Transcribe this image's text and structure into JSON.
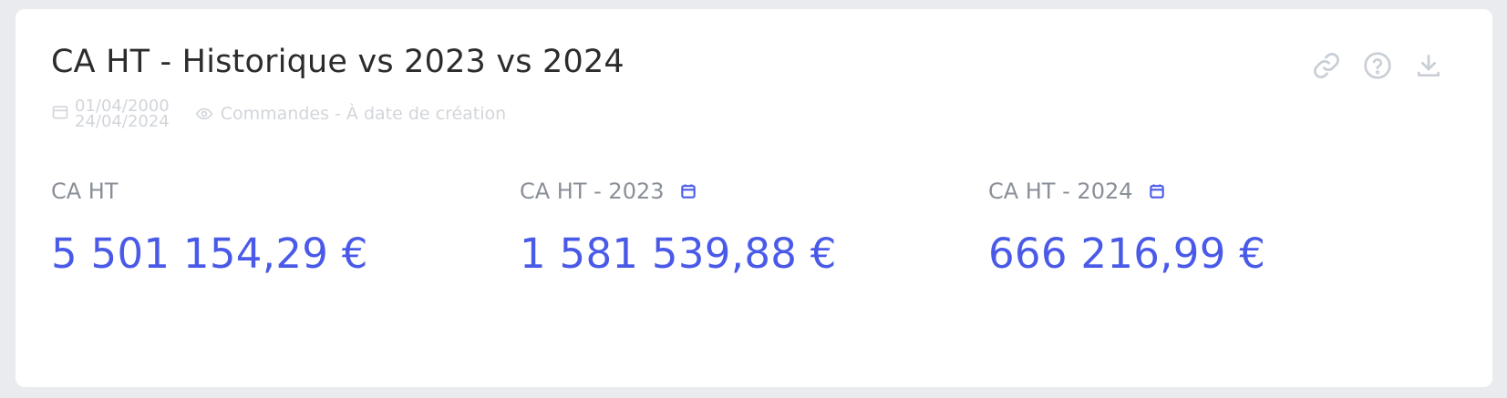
{
  "card": {
    "title": "CA HT - Historique vs 2023 vs 2024",
    "date_start": "01/04/2000",
    "date_end": "24/04/2024",
    "source": "Commandes - À date de création"
  },
  "actions": {
    "link_icon": "link-icon",
    "help_icon": "help-circle-icon",
    "download_icon": "download-icon"
  },
  "kpis": [
    {
      "label": "CA HT",
      "value": "5 501 154,29 €",
      "has_calendar": false
    },
    {
      "label": "CA HT - 2023",
      "value": "1 581 539,88 €",
      "has_calendar": true
    },
    {
      "label": "CA HT - 2024",
      "value": "666 216,99 €",
      "has_calendar": true
    }
  ],
  "colors": {
    "accent": "#4a5ae8",
    "label": "#8a8f98",
    "muted": "#d2d5da",
    "background": "#e9ebee",
    "card": "#ffffff"
  }
}
